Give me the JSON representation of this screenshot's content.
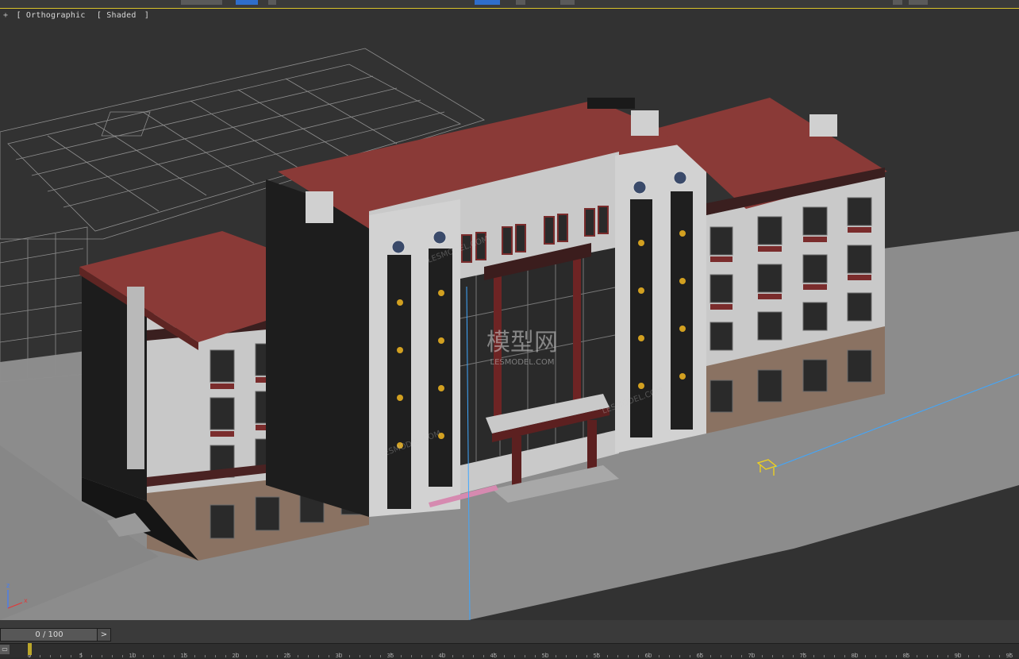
{
  "viewport": {
    "label_open": "+",
    "view_name": "Orthographic",
    "shading_mode": "Shaded",
    "label_close": "]",
    "axis": {
      "x": "x",
      "z": "z"
    },
    "watermark": {
      "logo_text": "模型网",
      "site": "LESMODEL.COM",
      "diagonal_text": "LESMODEL.COM"
    }
  },
  "timeline": {
    "frame_counter": "0 / 100",
    "next_label": ">",
    "ticks": [
      "0",
      "5",
      "10",
      "15",
      "20",
      "25",
      "30",
      "35",
      "40",
      "45",
      "50",
      "55",
      "60",
      "65",
      "70",
      "75",
      "80",
      "85",
      "90",
      "95",
      "100"
    ]
  },
  "colors": {
    "roof": "#8a3a37",
    "wall": "#c9c9c9",
    "dark_panel": "#1f1f1f",
    "stone_base": "#8a7262",
    "ground": "#8f8f8f",
    "viewport_bg": "#323232",
    "accent_border": "#d8c32a",
    "selection": "#2f6ecb"
  }
}
